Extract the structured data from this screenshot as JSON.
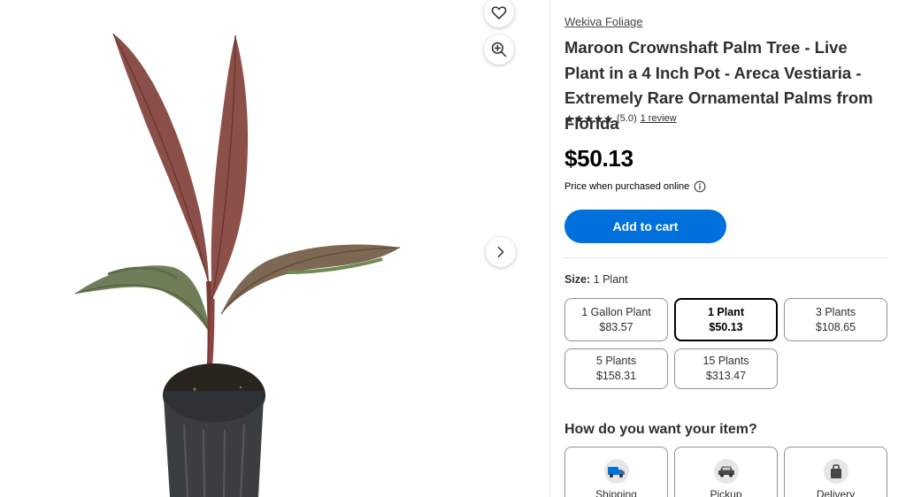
{
  "product": {
    "brand": "Wekiva Foliage",
    "title": "Maroon Crownshaft Palm Tree - Live Plant in a 4 Inch Pot - Areca Vestiaria - Extremely Rare Ornamental Palms from Florida",
    "rating_value": "(5.0)",
    "rating_stars": 5,
    "review_link": "1 review",
    "price": "$50.13",
    "price_note": "Price when purchased online",
    "add_to_cart": "Add to cart"
  },
  "size": {
    "label": "Size:",
    "selected_value": "1 Plant",
    "options": [
      {
        "name": "1 Gallon Plant",
        "price": "$83.57",
        "selected": false
      },
      {
        "name": "1 Plant",
        "price": "$50.13",
        "selected": true
      },
      {
        "name": "3 Plants",
        "price": "$108.65",
        "selected": false
      },
      {
        "name": "5 Plants",
        "price": "$158.31",
        "selected": false
      },
      {
        "name": "15 Plants",
        "price": "$313.47",
        "selected": false
      }
    ]
  },
  "fulfillment": {
    "heading": "How do you want your item?",
    "options": [
      {
        "label": "Shipping",
        "icon": "shipping-truck-icon"
      },
      {
        "label": "Pickup",
        "icon": "pickup-car-icon"
      },
      {
        "label": "Delivery",
        "icon": "delivery-bag-icon"
      }
    ]
  },
  "icons": {
    "favorite": "heart-icon",
    "zoom": "zoom-in-icon",
    "next": "chevron-right-icon",
    "info": "info-icon",
    "star": "star-icon"
  },
  "colors": {
    "accent": "#0071dc",
    "star": "#2e2f32",
    "leaf": "#8a4a45",
    "pot": "#3a3d40"
  }
}
